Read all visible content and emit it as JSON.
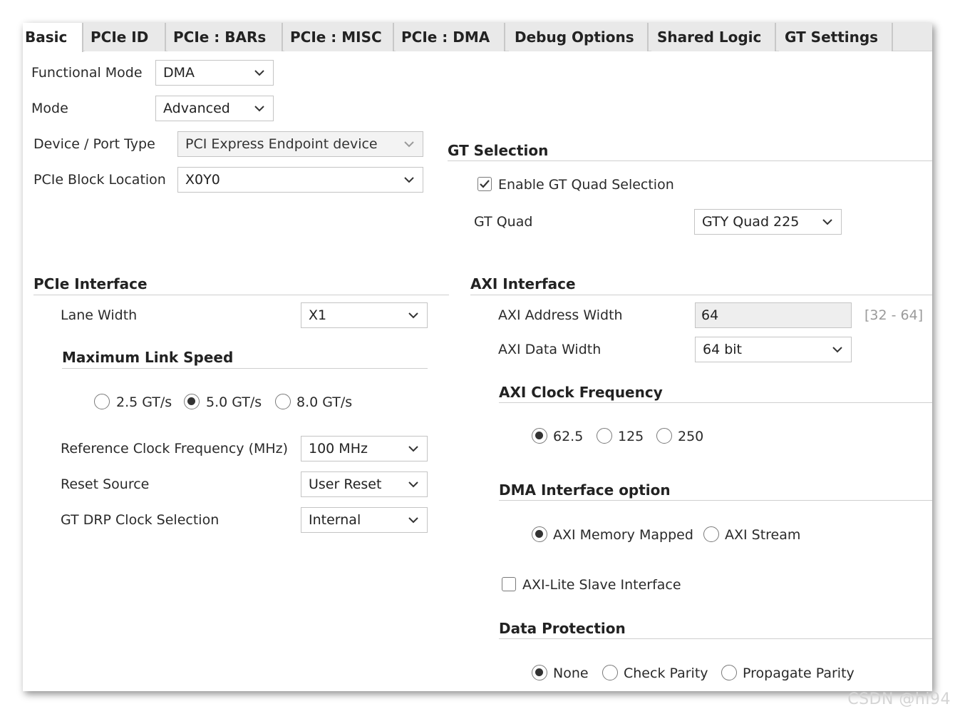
{
  "tabs": [
    {
      "label": "Basic",
      "active": true
    },
    {
      "label": "PCIe ID",
      "active": false
    },
    {
      "label": "PCIe : BARs",
      "active": false
    },
    {
      "label": "PCIe : MISC",
      "active": false
    },
    {
      "label": "PCIe : DMA",
      "active": false
    },
    {
      "label": "Debug Options",
      "active": false
    },
    {
      "label": "Shared Logic",
      "active": false
    },
    {
      "label": "GT Settings",
      "active": false
    }
  ],
  "basic": {
    "functional_mode": {
      "label": "Functional Mode",
      "value": "DMA"
    },
    "mode": {
      "label": "Mode",
      "value": "Advanced"
    },
    "device_port_type": {
      "label": "Device / Port Type",
      "value": "PCI Express Endpoint device",
      "disabled": true
    },
    "pcie_block_location": {
      "label": "PCIe Block Location",
      "value": "X0Y0"
    }
  },
  "gt_selection": {
    "title": "GT Selection",
    "enable_gt_quad": {
      "label": "Enable GT Quad Selection",
      "checked": true
    },
    "gt_quad": {
      "label": "GT Quad",
      "value": "GTY Quad 225"
    }
  },
  "pcie_interface": {
    "title": "PCIe Interface",
    "lane_width": {
      "label": "Lane Width",
      "value": "X1"
    },
    "max_link_speed": {
      "title": "Maximum Link Speed",
      "options": [
        "2.5 GT/s",
        "5.0 GT/s",
        "8.0 GT/s"
      ],
      "selected": "5.0 GT/s"
    },
    "ref_clock": {
      "label": "Reference Clock Frequency (MHz)",
      "value": "100 MHz"
    },
    "reset_source": {
      "label": "Reset Source",
      "value": "User Reset"
    },
    "gt_drp_clock": {
      "label": "GT DRP Clock Selection",
      "value": "Internal"
    }
  },
  "axi_interface": {
    "title": "AXI Interface",
    "address_width": {
      "label": "AXI Address Width",
      "value": "64",
      "range": "[32 - 64]"
    },
    "data_width": {
      "label": "AXI Data Width",
      "value": "64 bit"
    },
    "clock_frequency": {
      "title": "AXI Clock Frequency",
      "options": [
        "62.5",
        "125",
        "250"
      ],
      "selected": "62.5"
    },
    "dma_interface_option": {
      "title": "DMA Interface option",
      "options": [
        "AXI Memory Mapped",
        "AXI Stream"
      ],
      "selected": "AXI Memory Mapped"
    },
    "axi_lite_slave": {
      "label": "AXI-Lite Slave Interface",
      "checked": false
    },
    "data_protection": {
      "title": "Data Protection",
      "options": [
        "None",
        "Check Parity",
        "Propagate Parity"
      ],
      "selected": "None"
    }
  },
  "watermark": "CSDN @hi94",
  "icons": {
    "dropdown": "chevron-down-icon",
    "checkmark": "checkmark-icon"
  }
}
